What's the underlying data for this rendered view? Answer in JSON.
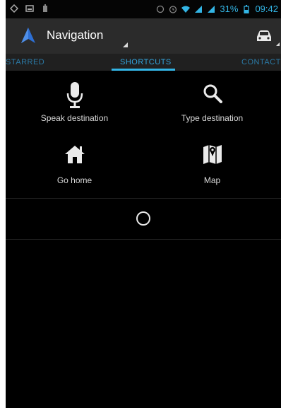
{
  "status_bar": {
    "battery": "31%",
    "time": "09:42",
    "left_icons": [
      "location-icon",
      "image-icon",
      "battery-small-icon"
    ],
    "right_icons": [
      "sync-icon",
      "alarm-icon",
      "wifi-icon",
      "signal-icon",
      "signal-icon"
    ]
  },
  "action_bar": {
    "title": "Navigation",
    "app_icon": "navigation-arrow-icon",
    "mode_icon": "car-icon"
  },
  "tabs": [
    {
      "label": "STARRED",
      "active": false
    },
    {
      "label": "SHORTCUTS",
      "active": true
    },
    {
      "label": "CONTACTS",
      "active": false
    }
  ],
  "shortcuts": [
    {
      "label": "Speak destination",
      "icon": "microphone-icon"
    },
    {
      "label": "Type destination",
      "icon": "search-icon"
    },
    {
      "label": "Go home",
      "icon": "home-icon"
    },
    {
      "label": "Map",
      "icon": "map-icon"
    }
  ],
  "colors": {
    "accent": "#33b5e5",
    "background": "#000000",
    "actionbar": "#2b2b2b",
    "app_icon": "#2d6fd4"
  }
}
